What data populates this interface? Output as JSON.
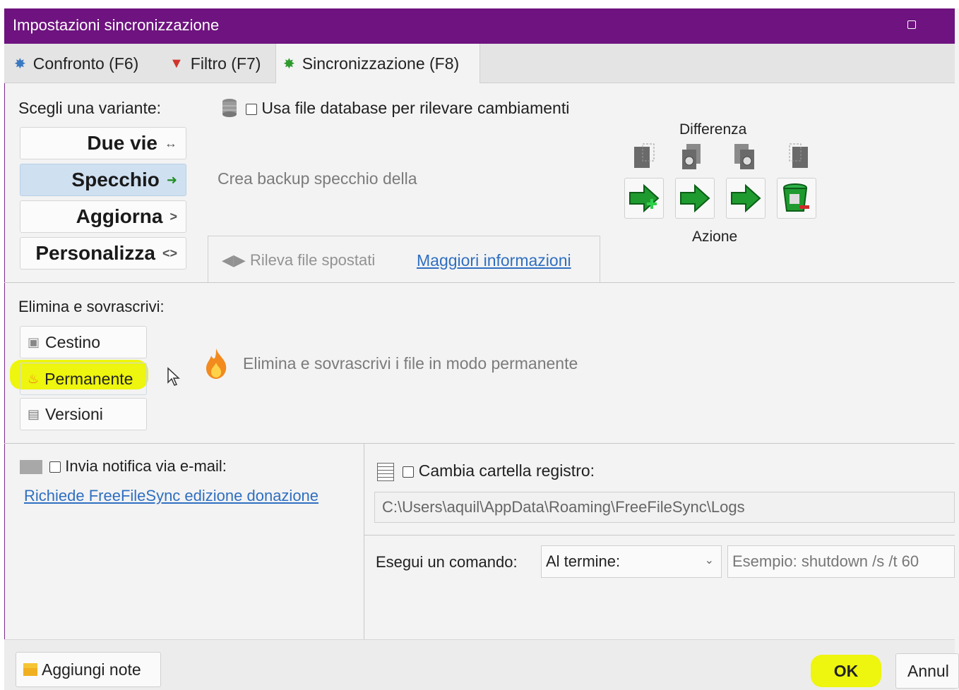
{
  "window": {
    "title": "Impostazioni sincronizzazione"
  },
  "tabs": [
    {
      "label": "Confronto (F6)",
      "icon": "gear-icon",
      "color": "#3a78c2"
    },
    {
      "label": "Filtro (F7)",
      "icon": "filter-icon",
      "color": "#d0342c"
    },
    {
      "label": "Sincronizzazione (F8)",
      "icon": "gear-icon",
      "color": "#2e9a2e",
      "active": true
    }
  ],
  "variant": {
    "label": "Scegli una variante:",
    "options": [
      {
        "label": "Due vie",
        "arrow": "↔"
      },
      {
        "label": "Specchio",
        "arrow": "➜",
        "selected": true
      },
      {
        "label": "Aggiorna",
        "arrow": ">"
      },
      {
        "label": "Personalizza",
        "arrow": "<>"
      }
    ],
    "description": "Crea backup specchio della"
  },
  "database": {
    "label": "Usa file database per rilevare cambiamenti",
    "checked": false
  },
  "moved_files": {
    "label": "Rileva file spostati",
    "link": "Maggiori informazioni"
  },
  "matrix": {
    "difference_label": "Differenza",
    "action_label": "Azione"
  },
  "delete": {
    "label": "Elimina e sovrascrivi:",
    "options": [
      {
        "label": "Cestino",
        "icon": "recycle-bin-icon"
      },
      {
        "label": "Permanente",
        "icon": "flame-icon",
        "selected": true
      },
      {
        "label": "Versioni",
        "icon": "versions-icon"
      }
    ],
    "description": "Elimina e sovrascrivi i file in modo permanente"
  },
  "email": {
    "label": "Invia notifica via e-mail:",
    "checked": false,
    "link": "Richiede FreeFileSync edizione donazione"
  },
  "log": {
    "label": "Cambia cartella registro:",
    "checked": false,
    "path": "C:\\Users\\aquil\\AppData\\Roaming\\FreeFileSync\\Logs"
  },
  "command": {
    "label": "Esegui un comando:",
    "when": "Al termine:",
    "placeholder": "Esempio: shutdown /s /t 60"
  },
  "footer": {
    "notes_label": "Aggiungi note",
    "ok_label": "OK",
    "cancel_label": "Annul"
  },
  "colors": {
    "titlebar": "#6e137f",
    "highlight": "#eef50e",
    "selected": "#cfe0f1",
    "link": "#2f6fc1"
  }
}
